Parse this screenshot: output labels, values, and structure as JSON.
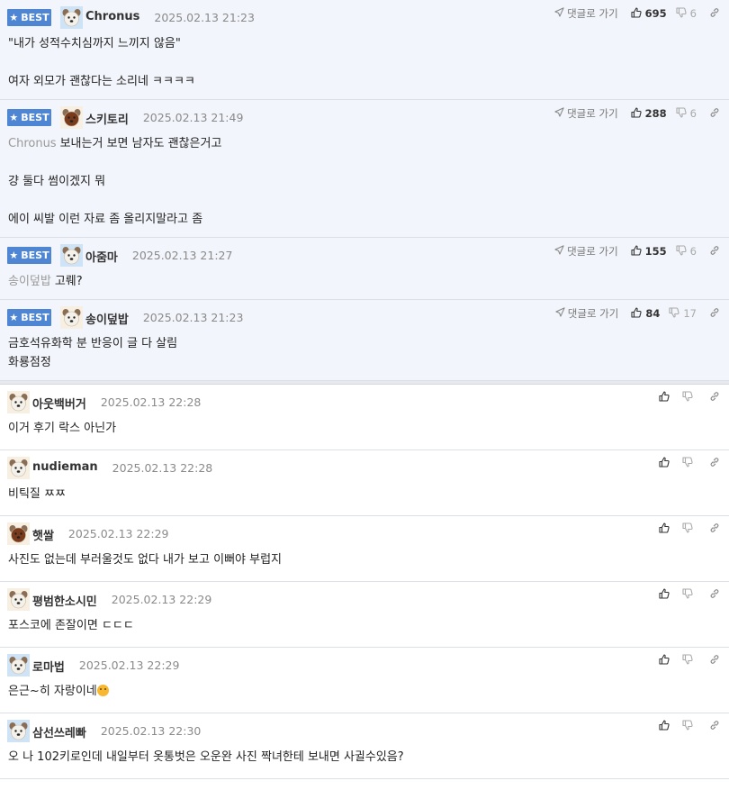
{
  "best_label": "BEST",
  "goto_label": "댓글로 가기",
  "colors": {
    "badge": "#4f86d4",
    "best_bg": "#f2f5fb",
    "mention": "#999999"
  },
  "best_comments": [
    {
      "nick": "Chronus",
      "date": "2025.02.13 21:23",
      "up": "695",
      "down": "6",
      "lines": [
        {
          "text": "\"내가 성적수치심까지 느끼지 않음\""
        },
        {
          "text": ""
        },
        {
          "text": "여자 외모가 괜찮다는 소리네 ㅋㅋㅋㅋ"
        }
      ]
    },
    {
      "nick": "스키토리",
      "date": "2025.02.13 21:49",
      "up": "288",
      "down": "6",
      "lines": [
        {
          "mention": "Chronus",
          "text": "보내는거 보면 남자도 괜찮은거고"
        },
        {
          "text": ""
        },
        {
          "text": "걍 둘다 썸이겠지 뭐"
        },
        {
          "text": ""
        },
        {
          "text": "에이 씨발 이런 자료 좀 올리지말라고 좀"
        }
      ]
    },
    {
      "nick": "아줌마",
      "date": "2025.02.13 21:27",
      "up": "155",
      "down": "6",
      "lines": [
        {
          "mention": "송이덮밥",
          "text": "고뤠?"
        }
      ]
    },
    {
      "nick": "송이덮밥",
      "date": "2025.02.13 21:23",
      "up": "84",
      "down": "17",
      "lines": [
        {
          "text": "금호석유화학 분 반응이 글 다 살림"
        },
        {
          "text": "화룡점정"
        }
      ]
    }
  ],
  "comments": [
    {
      "nick": "아웃백버거",
      "date": "2025.02.13 22:28",
      "lines": [
        {
          "text": "이거 후기 락스 아닌가"
        }
      ]
    },
    {
      "nick": "nudieman",
      "date": "2025.02.13 22:28",
      "lines": [
        {
          "text": "비틱질 ㅉㅉ"
        }
      ]
    },
    {
      "nick": "햇쌀",
      "date": "2025.02.13 22:29",
      "lines": [
        {
          "text": "사진도 없는데 부러울것도 없다 내가 보고 이뻐야 부럽지"
        }
      ]
    },
    {
      "nick": "평범한소시민",
      "date": "2025.02.13 22:29",
      "lines": [
        {
          "text": "포스코에 존잘이면 ㄷㄷㄷ"
        }
      ]
    },
    {
      "nick": "로마법",
      "date": "2025.02.13 22:29",
      "lines": [
        {
          "text": "은근~히 자랑이네",
          "emoji": "smile-emoji"
        }
      ]
    },
    {
      "nick": "삼선쓰레빠",
      "date": "2025.02.13 22:30",
      "lines": [
        {
          "text": "오 나 102키로인데 내일부터 옷통벗은 오운완 사진 짝녀한테 보내면 사귈수있음?"
        }
      ]
    }
  ]
}
